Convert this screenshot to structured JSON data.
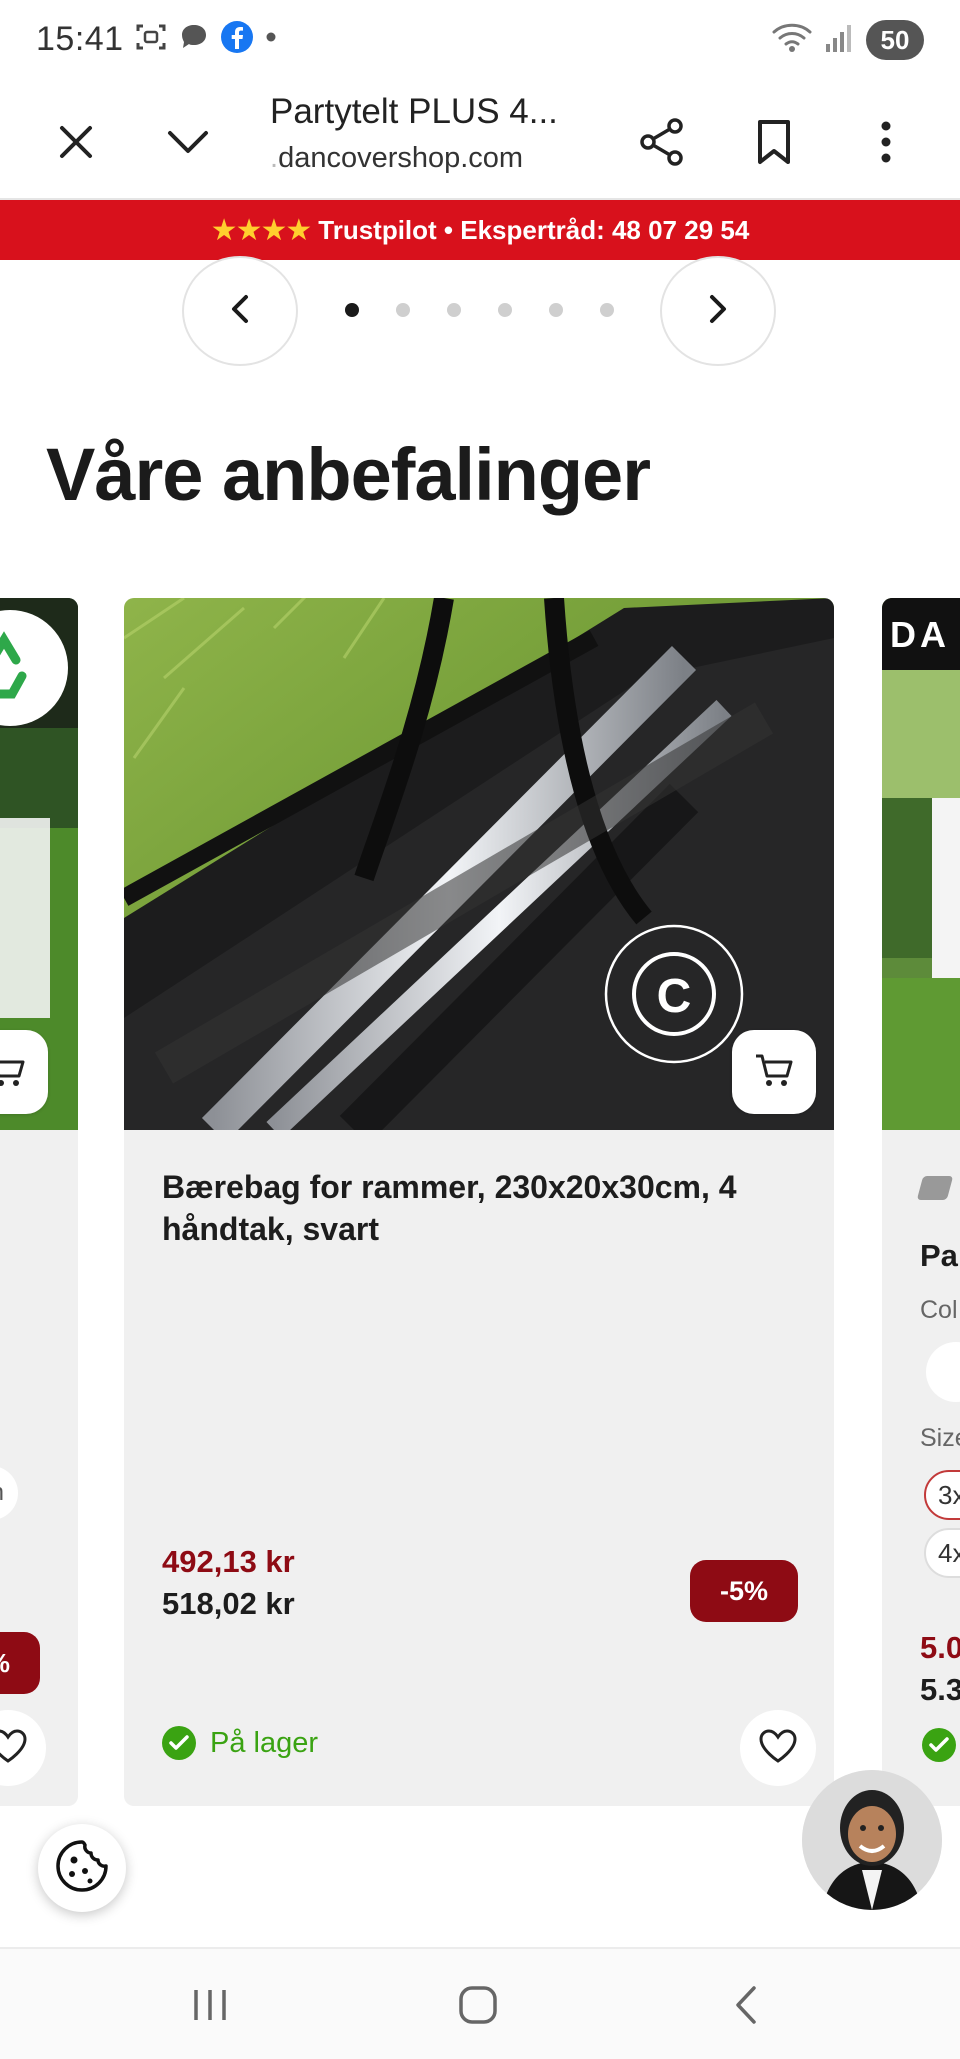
{
  "status_bar": {
    "time": "15:41",
    "battery": "50",
    "icons_left": [
      "screenshot-icon",
      "chat-icon",
      "facebook-icon",
      "dot-icon"
    ],
    "icons_right": [
      "wifi-icon",
      "signal-icon",
      "battery-icon"
    ]
  },
  "browser": {
    "page_title": "Partytelt PLUS 4...",
    "url_fade": ".",
    "url": "dancovershop.com",
    "icons": [
      "close-icon",
      "chevron-down-icon",
      "share-icon",
      "bookmark-icon",
      "more-icon"
    ]
  },
  "promo": {
    "stars": "★★★★",
    "text": "Trustpilot • Ekspertråd: 48 07 29 54"
  },
  "carousel": {
    "dots_total": 6,
    "active_index": 0
  },
  "section": {
    "heading": "Våre anbefalinger"
  },
  "products": {
    "main": {
      "title": "Bærebag for rammer, 230x20x30cm, 4 håndtak, svart",
      "sale_price": "492,13 kr",
      "original_price": "518,02 kr",
      "discount": "-5%",
      "stock": "På lager",
      "watermark": "DANCOVER"
    },
    "left_partial": {
      "discount_partial": "%",
      "size_partial": "n"
    },
    "right_partial": {
      "logo_partial": "DA",
      "title_partial": "Pa",
      "color_label_partial": "Col",
      "size_label_partial": "Size",
      "size_option_1": "3x",
      "size_option_2": "4x",
      "sale_price_partial": "5.0",
      "original_price_partial": "5.3"
    }
  },
  "colors": {
    "promo_red": "#d8111c",
    "sale_red": "#8e0b14",
    "stock_green": "#3aa312"
  }
}
